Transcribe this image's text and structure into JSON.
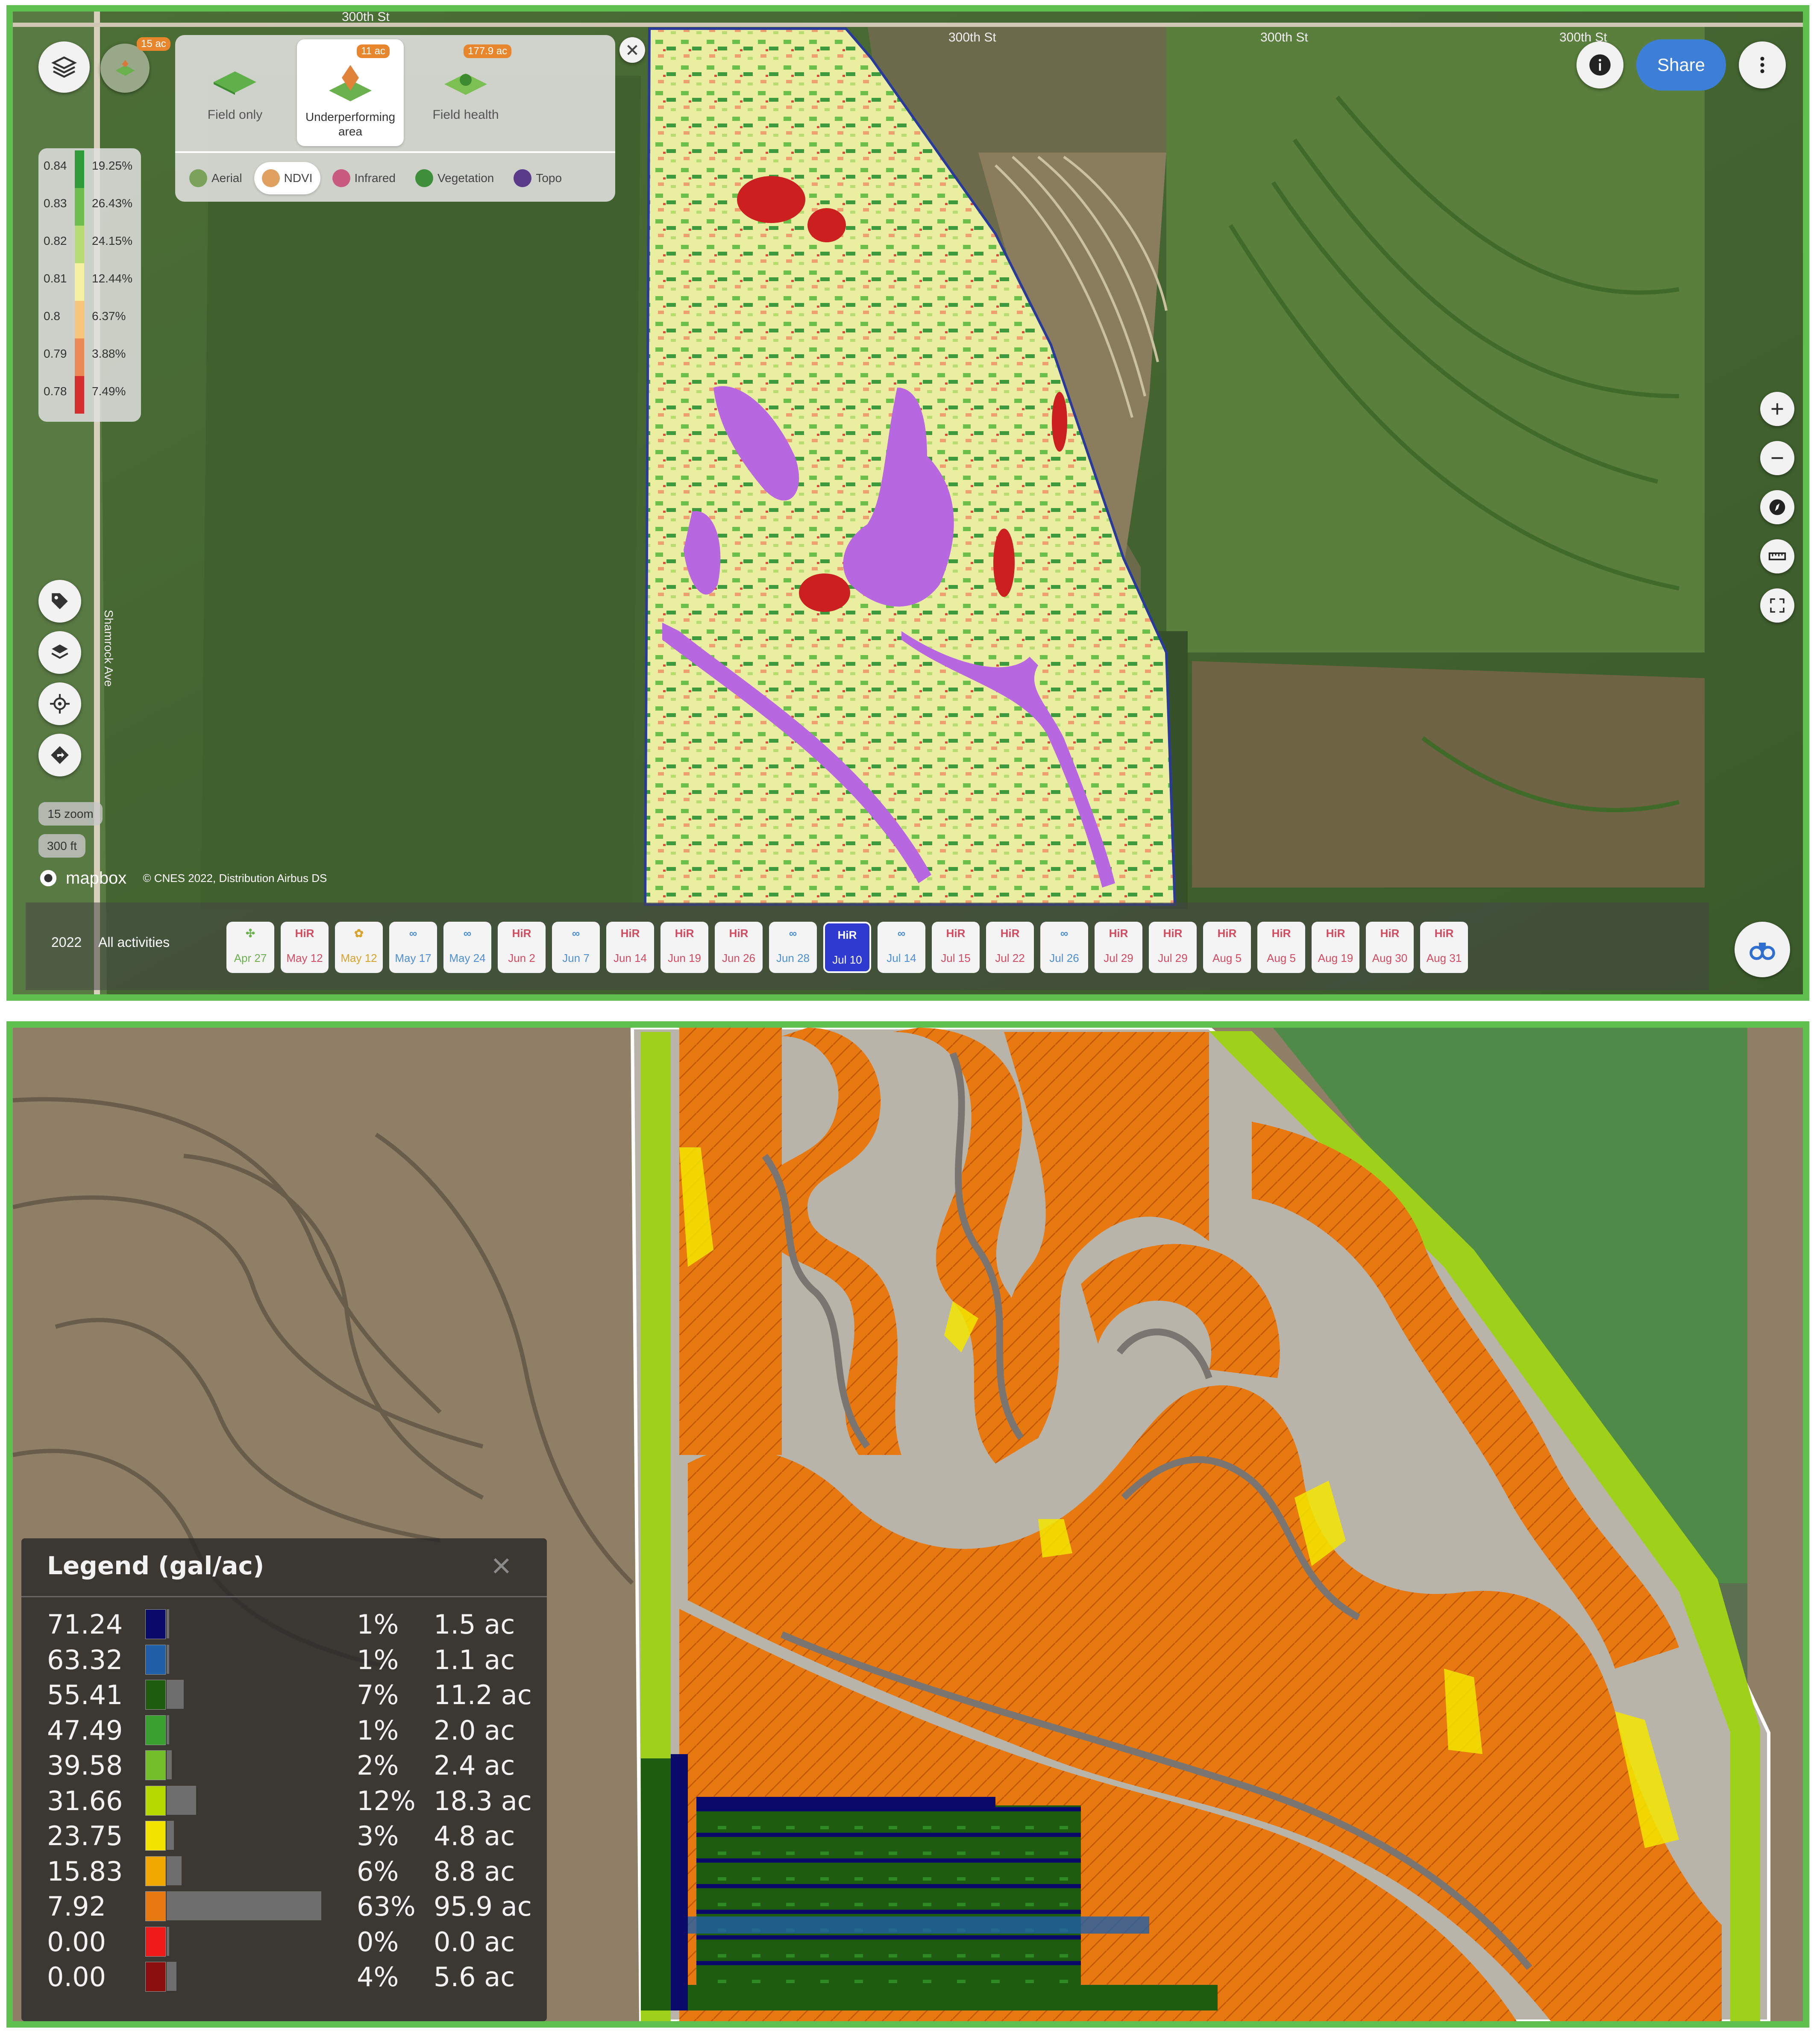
{
  "top_map": {
    "road_labels": [
      "300th St",
      "300th St",
      "300th St",
      "300th St"
    ],
    "side_road_label": "Shamrock Ave",
    "layer_cards": [
      {
        "label": "Field only",
        "badge": ""
      },
      {
        "label": "Underperforming area",
        "badge": "11 ac"
      },
      {
        "label": "Field health",
        "badge": "177.9 ac"
      }
    ],
    "layers_badge": "15 ac",
    "imagery_modes": [
      {
        "label": "Aerial",
        "color": "#7aa25a",
        "selected": false
      },
      {
        "label": "NDVI",
        "color": "#e0a060",
        "selected": true
      },
      {
        "label": "Infrared",
        "color": "#c85a80",
        "selected": false
      },
      {
        "label": "Vegetation",
        "color": "#3f8f3a",
        "selected": false
      },
      {
        "label": "Topo",
        "color": "#5a3b8a",
        "selected": false
      }
    ],
    "ndvi_legend": [
      {
        "value": "0.84",
        "pct": "19.25%",
        "color": "#2e9b3a"
      },
      {
        "value": "0.83",
        "pct": "26.43%",
        "color": "#6cbf4a"
      },
      {
        "value": "0.82",
        "pct": "24.15%",
        "color": "#b7dd72"
      },
      {
        "value": "0.81",
        "pct": "12.44%",
        "color": "#f5f0a0"
      },
      {
        "value": "0.8",
        "pct": "6.37%",
        "color": "#f4c57a"
      },
      {
        "value": "0.79",
        "pct": "3.88%",
        "color": "#ec8a55"
      },
      {
        "value": "0.78",
        "pct": "7.49%",
        "color": "#d62f2f"
      }
    ],
    "share_label": "Share",
    "zoom_label": "15 zoom",
    "scale_label": "300 ft",
    "mapbox_label": "mapbox",
    "attribution": "© CNES 2022, Distribution Airbus DS",
    "timeline": {
      "year": "2022",
      "filter": "All activities",
      "items": [
        {
          "date": "Apr 27",
          "kind": "plant"
        },
        {
          "date": "May 12",
          "kind": "HiR"
        },
        {
          "date": "May 12",
          "kind": "sprout"
        },
        {
          "date": "May 17",
          "kind": "scout"
        },
        {
          "date": "May 24",
          "kind": "scout"
        },
        {
          "date": "Jun 2",
          "kind": "HiR"
        },
        {
          "date": "Jun 7",
          "kind": "scout"
        },
        {
          "date": "Jun 14",
          "kind": "HiR"
        },
        {
          "date": "Jun 19",
          "kind": "HiR"
        },
        {
          "date": "Jun 26",
          "kind": "HiR"
        },
        {
          "date": "Jun 28",
          "kind": "scout"
        },
        {
          "date": "Jul 10",
          "kind": "HiR",
          "selected": true
        },
        {
          "date": "Jul 14",
          "kind": "scout"
        },
        {
          "date": "Jul 15",
          "kind": "HiR"
        },
        {
          "date": "Jul 22",
          "kind": "HiR"
        },
        {
          "date": "Jul 26",
          "kind": "scout"
        },
        {
          "date": "Jul 29",
          "kind": "HiR"
        },
        {
          "date": "Jul 29",
          "kind": "HiR"
        },
        {
          "date": "Aug 5",
          "kind": "HiR"
        },
        {
          "date": "Aug 5",
          "kind": "HiR"
        },
        {
          "date": "Aug 19",
          "kind": "HiR"
        },
        {
          "date": "Aug 30",
          "kind": "HiR"
        },
        {
          "date": "Aug 31",
          "kind": "HiR"
        }
      ],
      "hir_text": "HiR"
    }
  },
  "bottom_map": {
    "legend": {
      "title": "Legend (gal/ac)",
      "close_glyph": "×",
      "rows": [
        {
          "value": "71.24",
          "color": "#0a0a6a",
          "pct": "1%",
          "area": "1.5 ac",
          "share": 0.01
        },
        {
          "value": "63.32",
          "color": "#1f5fa8",
          "pct": "1%",
          "area": "1.1 ac",
          "share": 0.01
        },
        {
          "value": "55.41",
          "color": "#1e5c10",
          "pct": "7%",
          "area": "11.2 ac",
          "share": 0.07
        },
        {
          "value": "47.49",
          "color": "#3aa030",
          "pct": "1%",
          "area": "2.0 ac",
          "share": 0.01
        },
        {
          "value": "39.58",
          "color": "#72bf2a",
          "pct": "2%",
          "area": "2.4 ac",
          "share": 0.02
        },
        {
          "value": "31.66",
          "color": "#b5d900",
          "pct": "12%",
          "area": "18.3 ac",
          "share": 0.12
        },
        {
          "value": "23.75",
          "color": "#f2e600",
          "pct": "3%",
          "area": "4.8 ac",
          "share": 0.03
        },
        {
          "value": "15.83",
          "color": "#f0a800",
          "pct": "6%",
          "area": "8.8 ac",
          "share": 0.06
        },
        {
          "value": "7.92",
          "color": "#e87810",
          "pct": "63%",
          "area": "95.9 ac",
          "share": 0.63
        },
        {
          "value": "0.00",
          "color": "#ee1a1a",
          "pct": "0%",
          "area": "0.0 ac",
          "share": 0.0
        },
        {
          "value": "0.00",
          "color": "#8a0f0f",
          "pct": "4%",
          "area": "5.6 ac",
          "share": 0.04
        }
      ]
    }
  }
}
